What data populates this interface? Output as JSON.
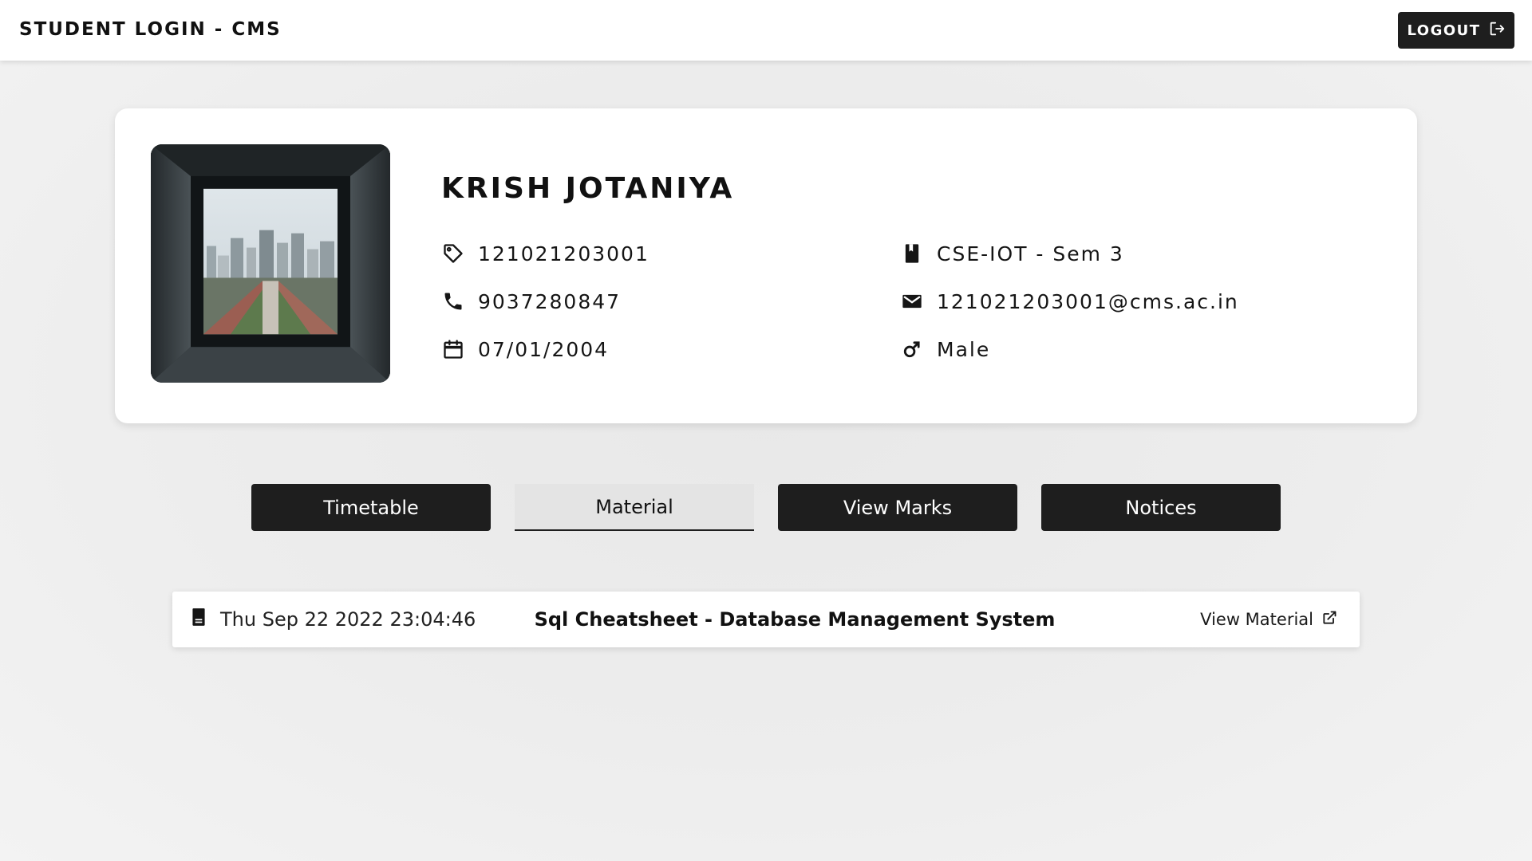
{
  "header": {
    "title": "STUDENT LOGIN - CMS",
    "logout_label": "LOGOUT"
  },
  "profile": {
    "name": "KRISH JOTANIYA",
    "enrollment": "121021203001",
    "phone": "9037280847",
    "dob": "07/01/2004",
    "branch_sem": "CSE-IOT - Sem 3",
    "email": "121021203001@cms.ac.in",
    "gender": "Male",
    "icons": {
      "enrollment": "tag-icon",
      "phone": "phone-icon",
      "dob": "calendar-icon",
      "branch": "book-icon",
      "email": "mail-icon",
      "gender": "male-icon"
    }
  },
  "tabs": [
    {
      "label": "Timetable",
      "active": false
    },
    {
      "label": "Material",
      "active": true
    },
    {
      "label": "View Marks",
      "active": false
    },
    {
      "label": "Notices",
      "active": false
    }
  ],
  "materials": [
    {
      "date": "Thu Sep 22 2022 23:04:46",
      "title": "Sql Cheatsheet - Database Management System",
      "link_label": "View Material"
    }
  ],
  "colors": {
    "dark": "#1e1e1e",
    "background": "#ececec",
    "card": "#ffffff"
  }
}
